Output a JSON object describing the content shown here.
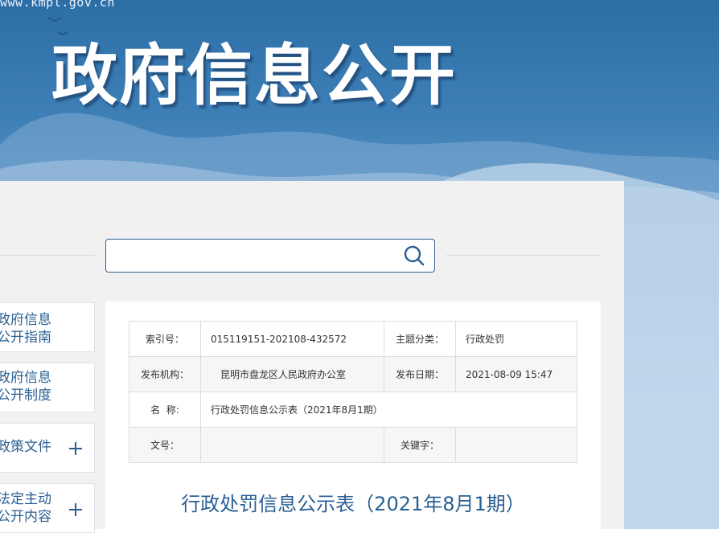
{
  "site": {
    "domain": "www.kmpl.gov.cn",
    "title": "政府信息公开"
  },
  "search": {
    "placeholder": ""
  },
  "sidebar": {
    "items": [
      {
        "label": "政府信息\n公开指南",
        "expandable": false
      },
      {
        "label": "政府信息\n公开制度",
        "expandable": false
      },
      {
        "label": "政策文件",
        "expandable": true
      },
      {
        "label": "法定主动\n公开内容",
        "expandable": true
      }
    ]
  },
  "meta": {
    "index_label": "索引号：",
    "index_value": "015119151-202108-432572",
    "topic_label": "主题分类：",
    "topic_value": "行政处罚",
    "org_label": "发布机构：",
    "org_value": "昆明市盘龙区人民政府办公室",
    "date_label": "发布日期：",
    "date_value": "2021-08-09 15:47",
    "name_label": "名  称:",
    "name_value": "行政处罚信息公示表（2021年8月1期）",
    "docno_label": "文号：",
    "docno_value": "",
    "keyword_label": "关键字：",
    "keyword_value": ""
  },
  "document": {
    "title": "行政处罚信息公示表（2021年8月1期）"
  },
  "colors": {
    "brand_blue": "#2a5f93",
    "banner_top": "#2c6ea6",
    "panel_bg": "#f1f1f1"
  }
}
